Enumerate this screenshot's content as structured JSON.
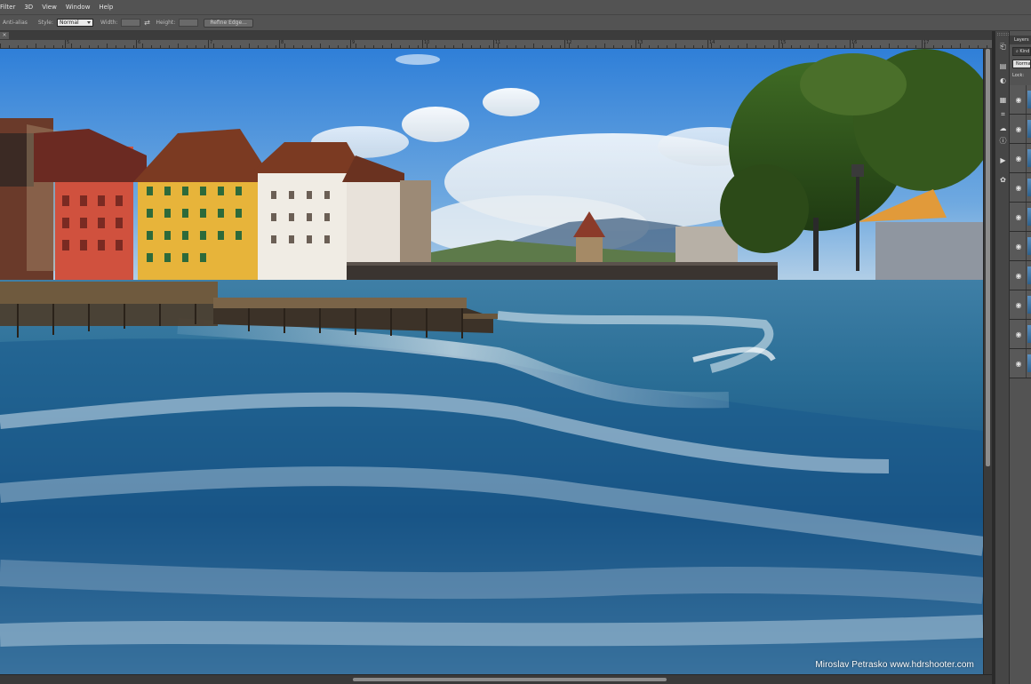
{
  "menu": [
    "Filter",
    "3D",
    "View",
    "Window",
    "Help"
  ],
  "options_bar": {
    "anti_alias": "Anti-alias",
    "style_label": "Style:",
    "style_value": "Normal",
    "width_label": "Width:",
    "height_label": "Height:",
    "refine_edge": "Refine Edge..."
  },
  "document_tab": {
    "close": "×"
  },
  "ruler": {
    "labels": [
      "5",
      "6",
      "7",
      "8",
      "9",
      "10",
      "11",
      "12",
      "13",
      "14",
      "15",
      "16",
      "17"
    ]
  },
  "canvas": {
    "watermark": "Miroslav  Petrasko  www.hdrshooter.com"
  },
  "toolstrip": {
    "icons": [
      "history-icon",
      "properties-icon",
      "adjustments-icon",
      "table-icon",
      "crop-icon",
      "cloud-icon",
      "info-icon",
      "play-icon",
      "clone-source-icon"
    ]
  },
  "layers_panel": {
    "title": "Layers",
    "kind": "⌕ Kind",
    "blend_mode": "Normal",
    "lock_label": "Lock:",
    "rows": 10
  },
  "colors": {
    "ui_dark": "#282828",
    "ui_mid": "#535353",
    "sky": "#3b85d6",
    "water": "#1e5f97"
  }
}
